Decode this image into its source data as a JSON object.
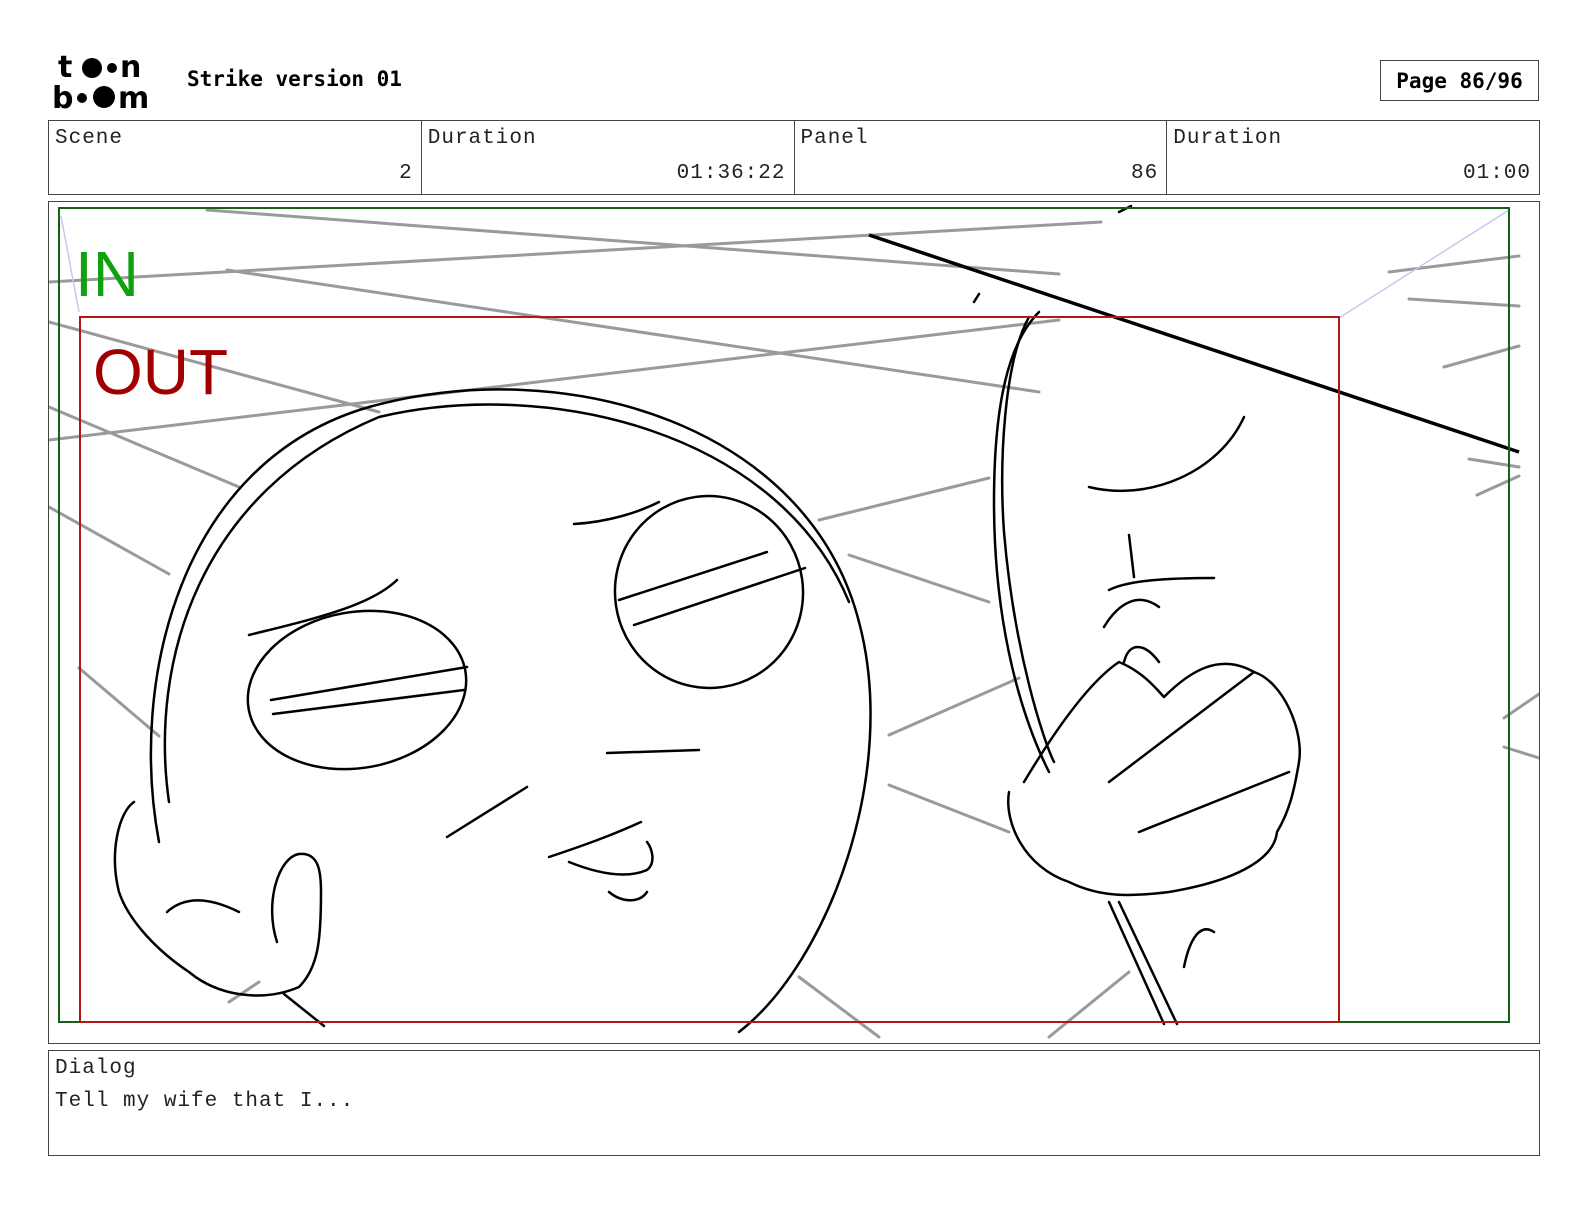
{
  "header": {
    "logo_text": [
      "toon",
      "boom"
    ],
    "title": "Strike version 01",
    "page_label": "Page 86/96"
  },
  "info": {
    "scene_label": "Scene",
    "scene_value": "2",
    "scene_duration_label": "Duration",
    "scene_duration_value": "01:36:22",
    "panel_label": "Panel",
    "panel_value": "86",
    "panel_duration_label": "Duration",
    "panel_duration_value": "01:00"
  },
  "panel": {
    "in_label": "IN",
    "out_label": "OUT",
    "in_color": "#10a010",
    "out_color": "#a00000"
  },
  "dialog": {
    "label": "Dialog",
    "text": "Tell my wife that I..."
  }
}
